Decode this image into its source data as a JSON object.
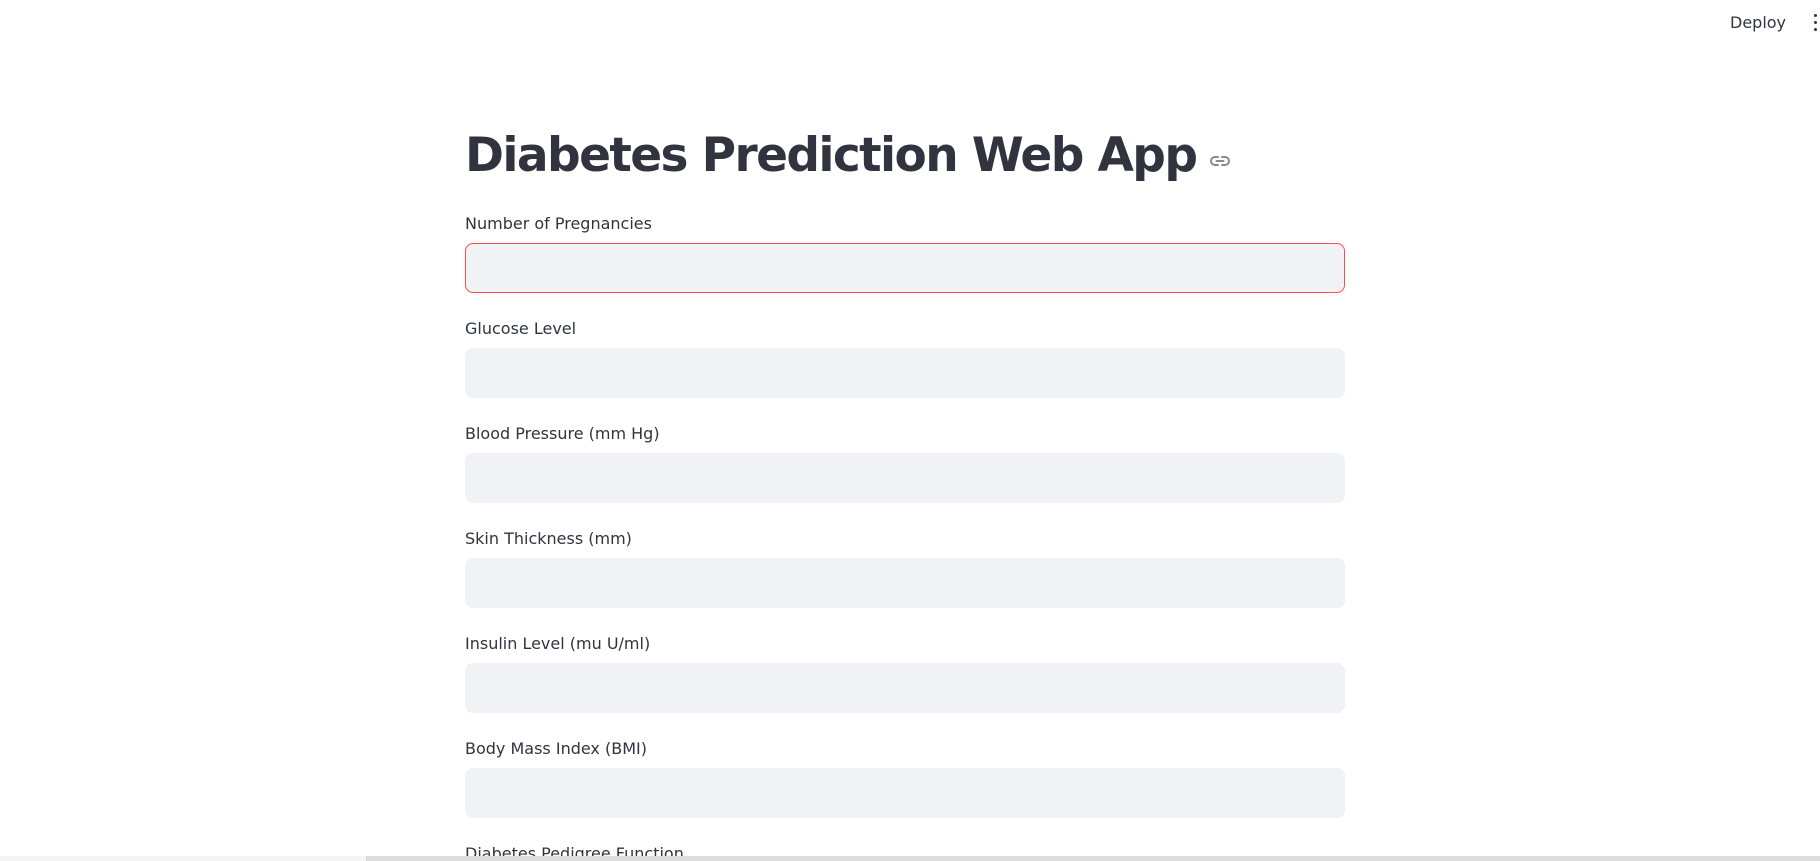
{
  "header": {
    "deploy_label": "Deploy",
    "menu_icon": "vertical-ellipsis-icon"
  },
  "main": {
    "title": "Diabetes Prediction Web App",
    "title_link_icon": "link-icon",
    "fields": [
      {
        "label": "Number of Pregnancies",
        "value": "",
        "placeholder": "",
        "focused": true
      },
      {
        "label": "Glucose Level",
        "value": "",
        "placeholder": ""
      },
      {
        "label": "Blood Pressure (mm Hg)",
        "value": "",
        "placeholder": ""
      },
      {
        "label": "Skin Thickness (mm)",
        "value": "",
        "placeholder": ""
      },
      {
        "label": "Insulin Level (mu U/ml)",
        "value": "",
        "placeholder": ""
      },
      {
        "label": "Body Mass Index (BMI)",
        "value": "",
        "placeholder": ""
      },
      {
        "label": "Diabetes Pedigree Function",
        "value": "",
        "placeholder": ""
      }
    ]
  },
  "colors": {
    "text": "#31333f",
    "input_background": "#f0f2f6",
    "focus_border": "#ff4b4b",
    "page_background": "#ffffff"
  }
}
